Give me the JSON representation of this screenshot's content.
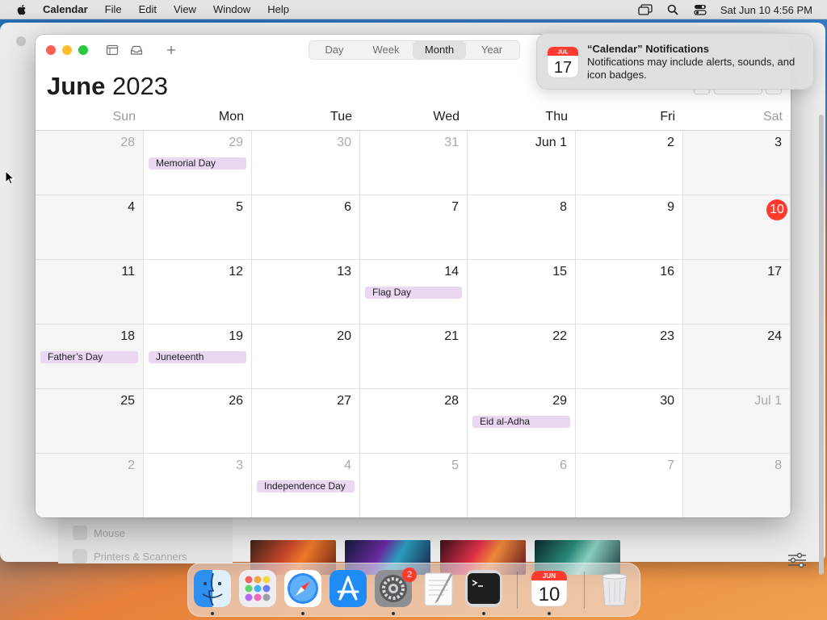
{
  "menubar": {
    "app_name": "Calendar",
    "items": [
      "File",
      "Edit",
      "View",
      "Window",
      "Help"
    ],
    "clock": "Sat Jun 10  4:56 PM"
  },
  "background_window": {
    "sidebar_items": [
      "Mouse",
      "Printers & Scanners"
    ]
  },
  "calendar": {
    "view_tabs": [
      "Day",
      "Week",
      "Month",
      "Year"
    ],
    "active_view": "Month",
    "month": "June",
    "year": "2023",
    "weekdays": [
      "Sun",
      "Mon",
      "Tue",
      "Wed",
      "Thu",
      "Fri",
      "Sat"
    ],
    "weeks": [
      [
        {
          "label": "28",
          "muted": true,
          "weekend": true
        },
        {
          "label": "29",
          "muted": true,
          "event": "Memorial Day"
        },
        {
          "label": "30",
          "muted": true
        },
        {
          "label": "31",
          "muted": true
        },
        {
          "label": "Jun 1"
        },
        {
          "label": "2"
        },
        {
          "label": "3",
          "weekend": true
        }
      ],
      [
        {
          "label": "4",
          "weekend": true
        },
        {
          "label": "5"
        },
        {
          "label": "6"
        },
        {
          "label": "7"
        },
        {
          "label": "8"
        },
        {
          "label": "9"
        },
        {
          "label": "10",
          "weekend": true,
          "today": true
        }
      ],
      [
        {
          "label": "11",
          "weekend": true
        },
        {
          "label": "12"
        },
        {
          "label": "13"
        },
        {
          "label": "14",
          "event": "Flag Day"
        },
        {
          "label": "15"
        },
        {
          "label": "16"
        },
        {
          "label": "17",
          "weekend": true
        }
      ],
      [
        {
          "label": "18",
          "weekend": true,
          "event": "Father’s Day"
        },
        {
          "label": "19",
          "event": "Juneteenth"
        },
        {
          "label": "20"
        },
        {
          "label": "21"
        },
        {
          "label": "22"
        },
        {
          "label": "23"
        },
        {
          "label": "24",
          "weekend": true
        }
      ],
      [
        {
          "label": "25",
          "weekend": true
        },
        {
          "label": "26"
        },
        {
          "label": "27"
        },
        {
          "label": "28"
        },
        {
          "label": "29",
          "event": "Eid al-Adha"
        },
        {
          "label": "30"
        },
        {
          "label": "Jul 1",
          "muted": true,
          "weekend": true
        }
      ],
      [
        {
          "label": "2",
          "muted": true,
          "weekend": true
        },
        {
          "label": "3",
          "muted": true
        },
        {
          "label": "4",
          "muted": true,
          "event": "Independence Day"
        },
        {
          "label": "5",
          "muted": true
        },
        {
          "label": "6",
          "muted": true
        },
        {
          "label": "7",
          "muted": true
        },
        {
          "label": "8",
          "muted": true,
          "weekend": true
        }
      ]
    ]
  },
  "notification": {
    "title": "“Calendar” Notifications",
    "body": "Notifications may include alerts, sounds, and icon badges.",
    "icon_month": "JUL",
    "icon_day": "17"
  },
  "dock": {
    "apps": [
      "Finder",
      "Launchpad",
      "Safari",
      "App Store",
      "System Settings",
      "TextEdit",
      "Terminal",
      "Calendar",
      "Trash"
    ],
    "settings_badge": "2",
    "calendar_icon_month": "JUN",
    "calendar_icon_day": "10"
  },
  "colors": {
    "today": "#ff3b30",
    "event_bg": "#ead8f3",
    "close": "#fe5f57",
    "minimize": "#febc2e",
    "zoom": "#28c840"
  }
}
